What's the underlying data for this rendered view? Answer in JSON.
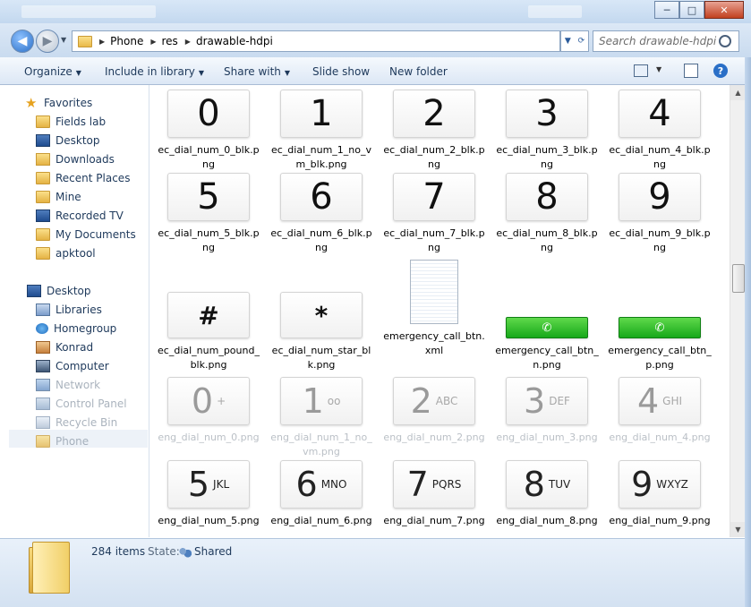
{
  "titlebar": {
    "buttons": {
      "minimize": "─",
      "maximize": "□",
      "close": "✕"
    }
  },
  "address": {
    "crumbs": [
      "Phone",
      "res",
      "drawable-hdpi"
    ],
    "search_placeholder": "Search drawable-hdpi"
  },
  "toolbar": {
    "organize": "Organize",
    "include_in_library": "Include in library",
    "share_with": "Share with",
    "slide_show": "Slide show",
    "new_folder": "New folder",
    "help": "?"
  },
  "nav": {
    "favorites_header": "Favorites",
    "favorites": [
      "Fields lab",
      "Desktop",
      "Downloads",
      "Recent Places",
      "Mine",
      "Recorded TV",
      "My Documents",
      "apktool"
    ],
    "desktop_header": "Desktop",
    "desktop_items": [
      "Libraries",
      "Homegroup",
      "Konrad",
      "Computer",
      "Network",
      "Control Panel",
      "Recycle Bin",
      "Phone"
    ]
  },
  "files": [
    {
      "name": "ec_dial_num_0_blk.png",
      "glyph": "0"
    },
    {
      "name": "ec_dial_num_1_no_vm_blk.png",
      "glyph": "1"
    },
    {
      "name": "ec_dial_num_2_blk.png",
      "glyph": "2"
    },
    {
      "name": "ec_dial_num_3_blk.png",
      "glyph": "3"
    },
    {
      "name": "ec_dial_num_4_blk.png",
      "glyph": "4"
    },
    {
      "name": "ec_dial_num_5_blk.png",
      "glyph": "5"
    },
    {
      "name": "ec_dial_num_6_blk.png",
      "glyph": "6"
    },
    {
      "name": "ec_dial_num_7_blk.png",
      "glyph": "7"
    },
    {
      "name": "ec_dial_num_8_blk.png",
      "glyph": "8"
    },
    {
      "name": "ec_dial_num_9_blk.png",
      "glyph": "9"
    },
    {
      "name": "ec_dial_num_pound_blk.png",
      "glyph": "#"
    },
    {
      "name": "ec_dial_num_star_blk.png",
      "glyph": "*"
    },
    {
      "name": "emergency_call_btn.xml",
      "glyph": ""
    },
    {
      "name": "emergency_call_btn_n.png",
      "glyph": "✆"
    },
    {
      "name": "emergency_call_btn_p.png",
      "glyph": "✆"
    },
    {
      "name": "eng_dial_num_0.png",
      "glyph": "0",
      "sub": "+"
    },
    {
      "name": "eng_dial_num_1_no_vm.png",
      "glyph": "1",
      "sub": "oo"
    },
    {
      "name": "eng_dial_num_2.png",
      "glyph": "2",
      "sub": "ABC"
    },
    {
      "name": "eng_dial_num_3.png",
      "glyph": "3",
      "sub": "DEF"
    },
    {
      "name": "eng_dial_num_4.png",
      "glyph": "4",
      "sub": "GHI"
    },
    {
      "name": "eng_dial_num_5.png",
      "glyph": "5",
      "sub": "JKL"
    },
    {
      "name": "eng_dial_num_6.png",
      "glyph": "6",
      "sub": "MNO"
    },
    {
      "name": "eng_dial_num_7.png",
      "glyph": "7",
      "sub": "PQRS"
    },
    {
      "name": "eng_dial_num_8.png",
      "glyph": "8",
      "sub": "TUV"
    },
    {
      "name": "eng_dial_num_9.png",
      "glyph": "9",
      "sub": "WXYZ"
    }
  ],
  "details": {
    "count": "284 items",
    "state_label": "State:",
    "state_value": "Shared"
  }
}
